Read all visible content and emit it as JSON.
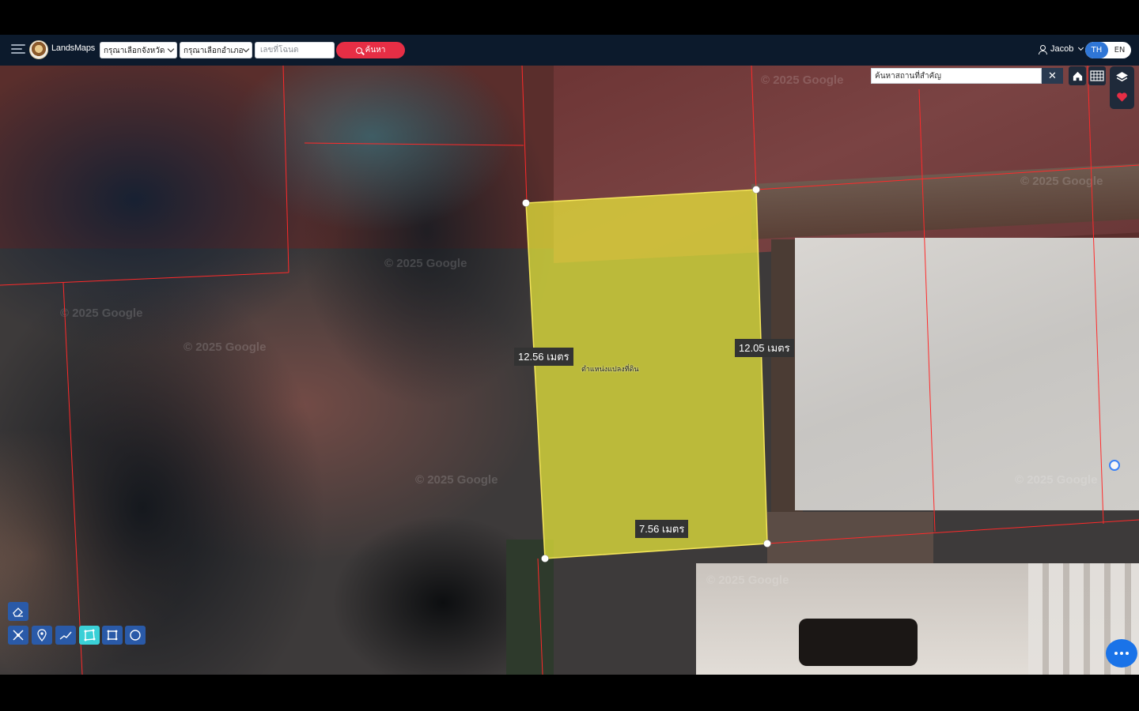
{
  "header": {
    "brand": "LandsMaps",
    "province_select": "กรุณาเลือกจังหวัด",
    "district_select": "กรุณาเลือกอำเภอ",
    "deed_placeholder": "เลขที่โฉนด",
    "search_label": "ค้นหา",
    "user_name": "Jacob",
    "lang_th": "TH",
    "lang_en": "EN"
  },
  "map": {
    "poi_search_placeholder": "ค้นหาสถานที่สำคัญ",
    "poi_clear": "✕",
    "watermark": "© 2025 Google",
    "parcel": {
      "caption": "ตำแหน่งแปลงที่ดิน",
      "fill_color": "#ecec3a",
      "edges": {
        "left": "12.56 เมตร",
        "right": "12.05 เมตร",
        "bottom": "7.56 เมตร"
      }
    },
    "boundary_color": "#ff2a2a"
  },
  "tools": {
    "active": "polygon-tool",
    "items": [
      "eraser",
      "measure",
      "pin",
      "line",
      "polygon",
      "rectangle",
      "circle"
    ]
  },
  "colors": {
    "topbar": "#0c1a2c",
    "search_button": "#e62e45",
    "tool_button": "#2a5aa8",
    "tool_active": "#3ad0d7"
  }
}
